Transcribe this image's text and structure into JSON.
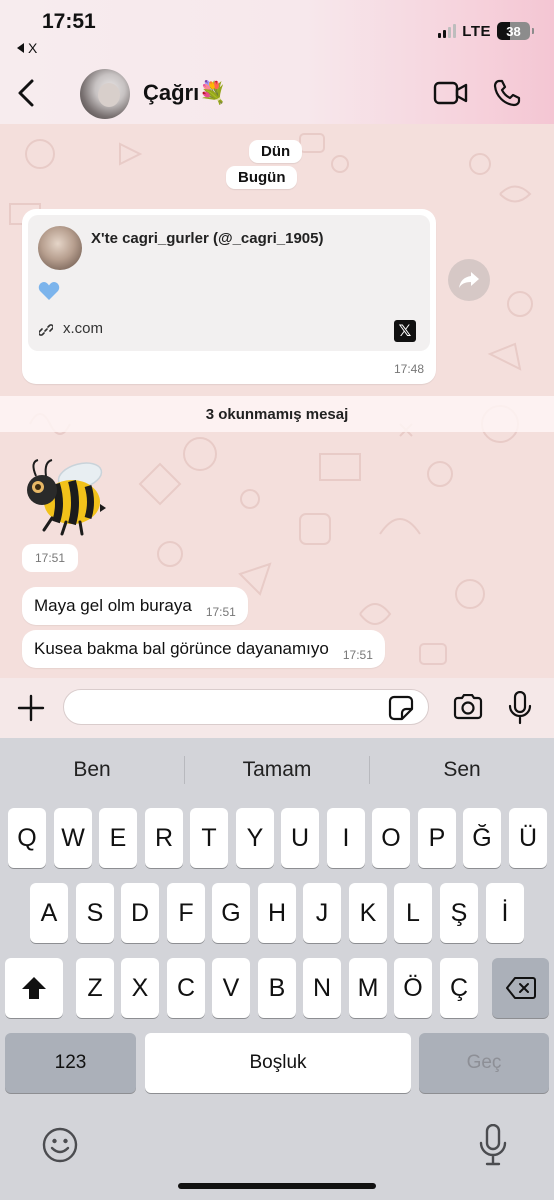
{
  "status_bar": {
    "time": "17:51",
    "back_app": "X",
    "network": "LTE",
    "battery": "38",
    "battery_level": 0.38
  },
  "header": {
    "contact_name": "Çağrı💐"
  },
  "chat": {
    "date_pills": [
      "Dün",
      "Bugün"
    ],
    "link_message": {
      "preview_title": "X'te cagri_gurler (@_cagri_1905)",
      "preview_body": "💙",
      "domain": "x.com",
      "time": "17:48"
    },
    "unread_banner": "3 okunmamış mesaj",
    "sticker": {
      "description_icon": "bee-sticker",
      "time": "17:51"
    },
    "messages": [
      {
        "text": "Maya gel olm buraya",
        "time": "17:51"
      },
      {
        "text": "Kusea bakma bal görünce dayanamıyo",
        "time": "17:51"
      }
    ]
  },
  "input": {
    "placeholder": ""
  },
  "keyboard": {
    "suggestions": [
      "Ben",
      "Tamam",
      "Sen"
    ],
    "row1": [
      "Q",
      "W",
      "E",
      "R",
      "T",
      "Y",
      "U",
      "I",
      "O",
      "P",
      "Ğ",
      "Ü"
    ],
    "row2": [
      "A",
      "S",
      "D",
      "F",
      "G",
      "H",
      "J",
      "K",
      "L",
      "Ş",
      "İ"
    ],
    "row3": [
      "Z",
      "X",
      "C",
      "V",
      "B",
      "N",
      "M",
      "Ö",
      "Ç"
    ],
    "numbers_label": "123",
    "space_label": "Boşluk",
    "go_label": "Geç"
  }
}
